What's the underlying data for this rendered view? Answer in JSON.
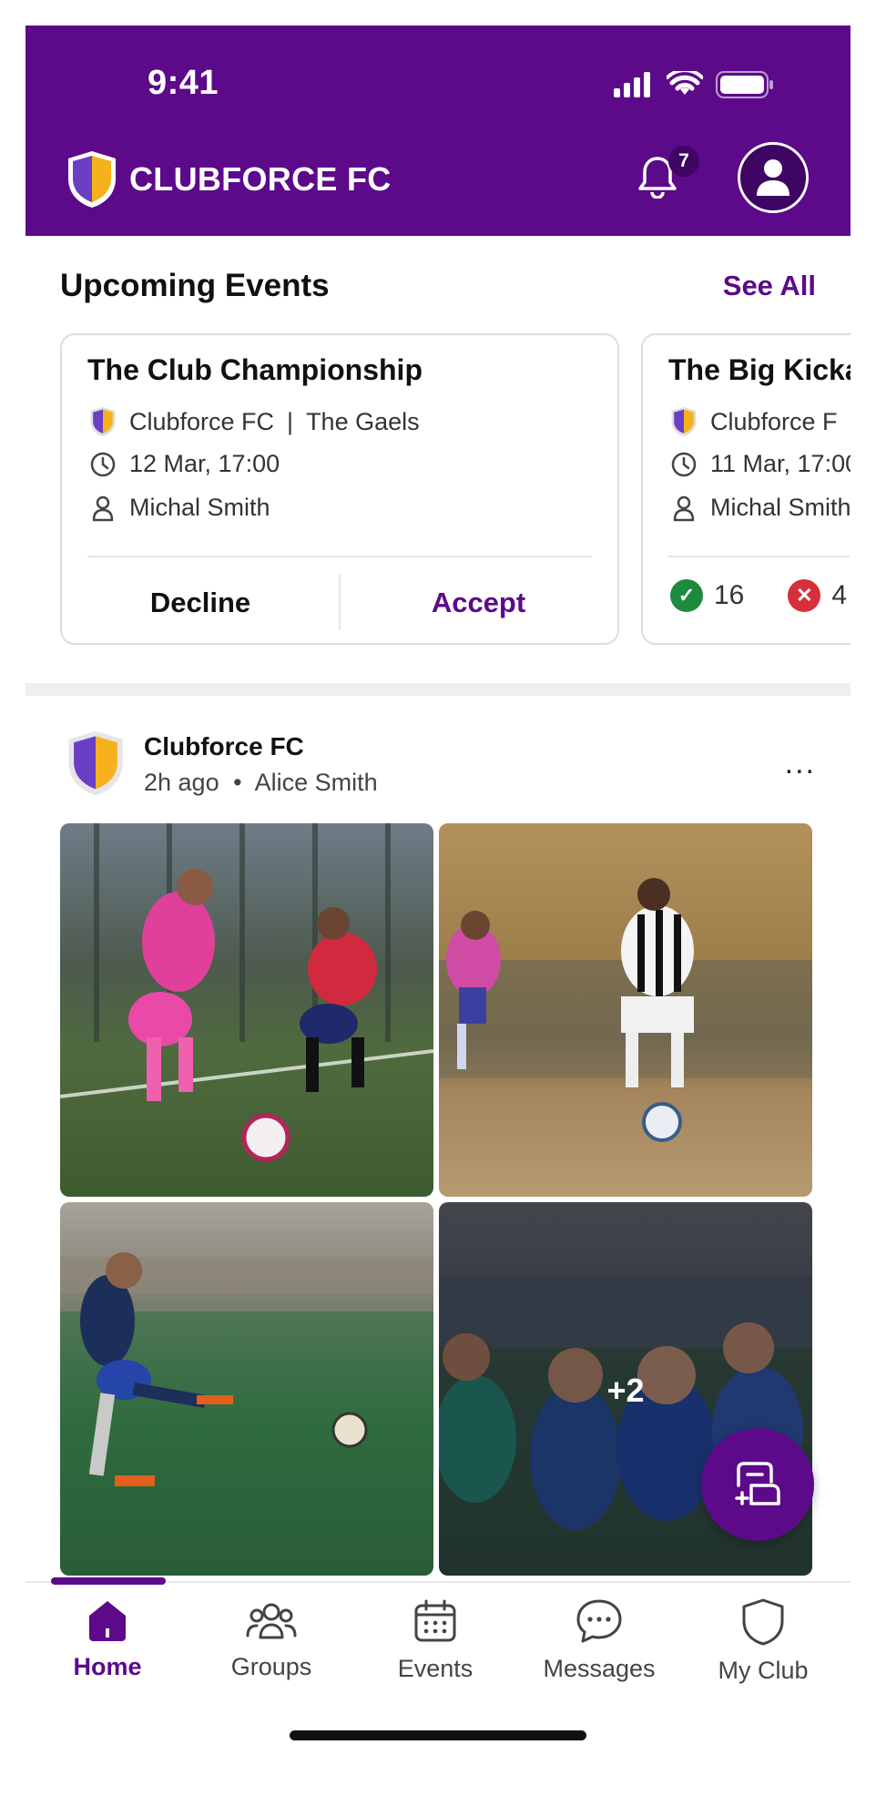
{
  "status_bar": {
    "time": "9:41"
  },
  "header": {
    "club_name": "CLUBFORCE FC",
    "notification_count": "7"
  },
  "upcoming": {
    "title": "Upcoming Events",
    "see_all": "See All",
    "events": [
      {
        "title": "The Club Championship",
        "teams": "Clubforce FC",
        "separator": "|",
        "opponent": "The Gaels",
        "datetime": "12 Mar, 17:00",
        "organizer": "Michal Smith",
        "decline": "Decline",
        "accept": "Accept"
      },
      {
        "title": "The Big Kicka",
        "teams": "Clubforce F",
        "datetime": "11 Mar, 17:00",
        "organizer": "Michal Smith",
        "accepted_count": "16",
        "declined_count": "4"
      }
    ]
  },
  "post": {
    "author": "Clubforce FC",
    "time": "2h ago",
    "dot": "•",
    "posted_by": "Alice Smith",
    "more": "...",
    "extra_photos": "+2"
  },
  "nav": {
    "items": [
      {
        "label": "Home"
      },
      {
        "label": "Groups"
      },
      {
        "label": "Events"
      },
      {
        "label": "Messages"
      },
      {
        "label": "My Club"
      }
    ]
  },
  "colors": {
    "brand": "#5c0a8a",
    "shield_left": "#6b3fc4",
    "shield_right": "#f5b21c",
    "accepted": "#1e8a3f",
    "declined": "#d6303b"
  }
}
